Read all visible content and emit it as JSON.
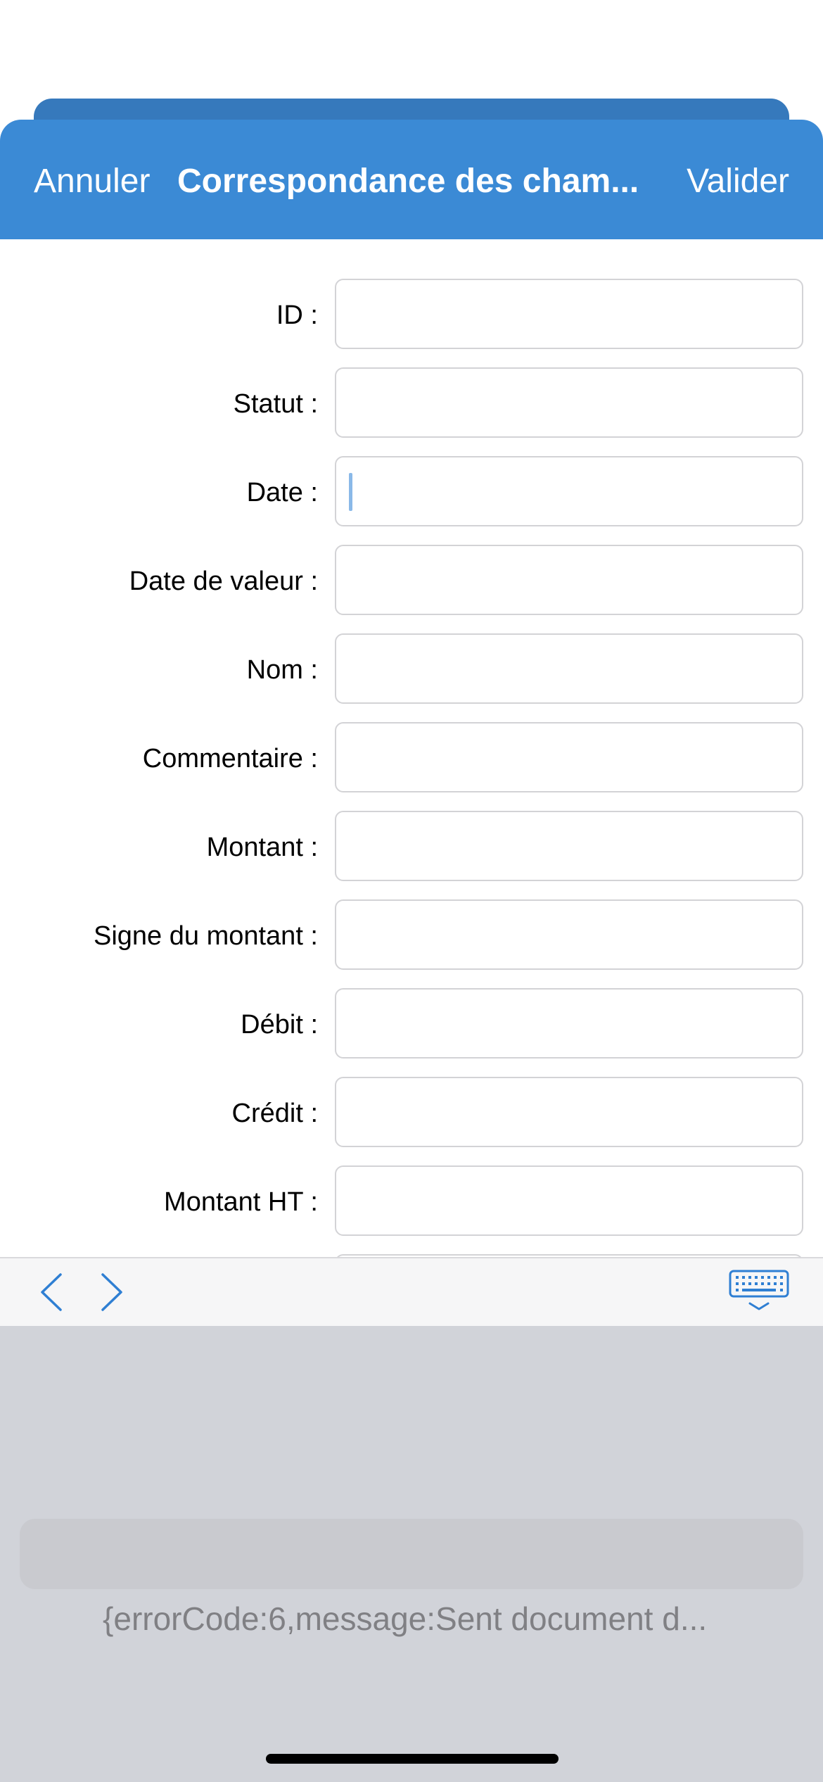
{
  "nav": {
    "cancel_label": "Annuler",
    "title": "Correspondance des cham...",
    "done_label": "Valider",
    "bar_color": "#3b8ad5",
    "text_color": "#ffffff"
  },
  "fields": [
    {
      "label": "ID :",
      "value": ""
    },
    {
      "label": "Statut :",
      "value": ""
    },
    {
      "label": "Date :",
      "value": ""
    },
    {
      "label": "Date de valeur :",
      "value": ""
    },
    {
      "label": "Nom :",
      "value": ""
    },
    {
      "label": "Commentaire :",
      "value": ""
    },
    {
      "label": "Montant :",
      "value": ""
    },
    {
      "label": "Signe du montant :",
      "value": ""
    },
    {
      "label": "Débit :",
      "value": ""
    },
    {
      "label": "Crédit :",
      "value": ""
    },
    {
      "label": "Montant HT :",
      "value": ""
    }
  ],
  "focused_field": "Date :",
  "toolbar": {
    "prev_icon": "chevron-left-icon",
    "next_icon": "chevron-right-icon",
    "dismiss_icon": "keyboard-dismiss-icon",
    "accent_color": "#2f7fd3"
  },
  "keyboard": {
    "error_text": "{errorCode:6,message:Sent document d..."
  }
}
